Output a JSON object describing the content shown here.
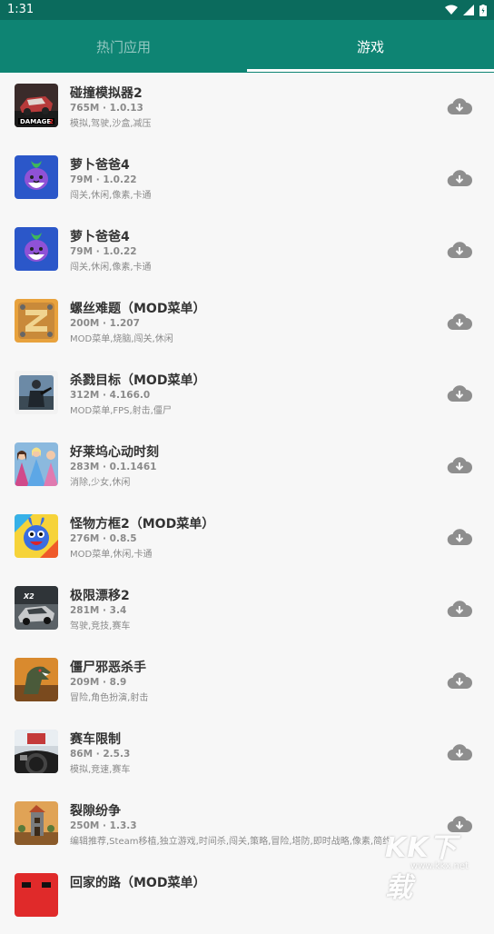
{
  "status": {
    "time": "1:31"
  },
  "tabs": [
    {
      "label": "热门应用",
      "selected": false
    },
    {
      "label": "游戏",
      "selected": true
    }
  ],
  "apps": [
    {
      "title": "碰撞模拟器2",
      "meta": "765M · 1.0.13",
      "tags": "模拟,驾驶,沙盒,减压",
      "icon": "car-crash-icon"
    },
    {
      "title": "萝卜爸爸4",
      "meta": "79M · 1.0.22",
      "tags": "闯关,休闲,像素,卡通",
      "icon": "radish-icon"
    },
    {
      "title": "萝卜爸爸4",
      "meta": "79M · 1.0.22",
      "tags": "闯关,休闲,像素,卡通",
      "icon": "radish-icon"
    },
    {
      "title": "螺丝难题（MOD菜单）",
      "meta": "200M · 1.207",
      "tags": "MOD菜单,烧脑,闯关,休闲",
      "icon": "screw-puzzle-icon"
    },
    {
      "title": "杀戮目标（MOD菜单）",
      "meta": "312M · 4.166.0",
      "tags": "MOD菜单,FPS,射击,僵尸",
      "icon": "soldier-icon"
    },
    {
      "title": "好莱坞心动时刻",
      "meta": "283M · 0.1.1461",
      "tags": "消除,少女,休闲",
      "icon": "princess-icon"
    },
    {
      "title": "怪物方框2（MOD菜单）",
      "meta": "276M · 0.8.5",
      "tags": "MOD菜单,休闲,卡通",
      "icon": "monster-icon"
    },
    {
      "title": "极限漂移2",
      "meta": "281M · 3.4",
      "tags": "驾驶,竞技,赛车",
      "icon": "drift-car-icon"
    },
    {
      "title": "僵尸邪恶杀手",
      "meta": "209M · 8.9",
      "tags": "冒险,角色扮演,射击",
      "icon": "dinosaur-icon"
    },
    {
      "title": "赛车限制",
      "meta": "86M · 2.5.3",
      "tags": "模拟,竞速,赛车",
      "icon": "steering-wheel-icon"
    },
    {
      "title": "裂隙纷争",
      "meta": "250M · 1.3.3",
      "tags": "编辑推荐,Steam移植,独立游戏,时间杀,闯关,策略,冒险,塔防,即时战略,像素,简约",
      "icon": "tower-icon"
    },
    {
      "title": "回家的路（MOD菜单）",
      "meta": "",
      "tags": "",
      "icon": "red-icon"
    }
  ],
  "watermark": {
    "text": "KK下载",
    "url": "www.kkx.net"
  },
  "colors": {
    "statusbar": "#0b6b5d",
    "tabbar": "#0e8473",
    "background": "#f7f7f7"
  }
}
